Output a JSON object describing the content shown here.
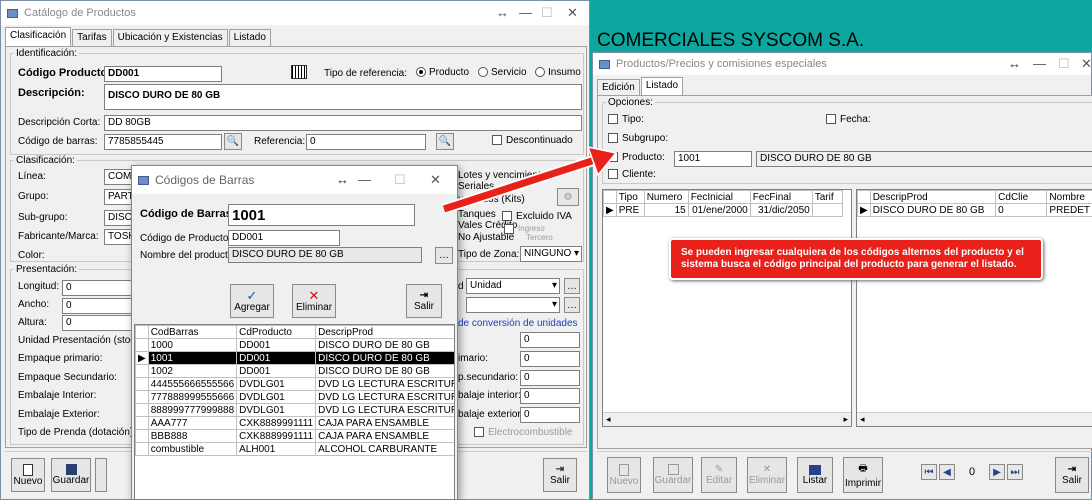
{
  "catalog": {
    "title": "Catálogo de Productos",
    "tabs": [
      "Clasificación",
      "Tarifas",
      "Ubicación y Existencias",
      "Listado"
    ],
    "identificacion": "Identificación:",
    "codigo_label": "Código Producto:",
    "codigo_value": "DD001",
    "tipo_ref_label": "Tipo de referencia:",
    "tipo_ref_options": [
      "Producto",
      "Servicio",
      "Insumo"
    ],
    "descripcion_label": "Descripción:",
    "descripcion_value": "DISCO DURO DE 80 GB",
    "desc_corta_label": "Descripción Corta:",
    "desc_corta_value": "DD 80GB",
    "codigo_barras_label": "Código de barras:",
    "codigo_barras_value": "7785855445",
    "referencia_label": "Referencia:",
    "referencia_value": "0",
    "descontinuado_label": "Descontinuado",
    "clasificacion": "Clasificación:",
    "linea_label": "Línea:",
    "linea_value": "COMP",
    "grupo_label": "Grupo:",
    "grupo_value": "PARTE",
    "subgrupo_label": "Sub-grupo:",
    "subgrupo_value": "DISCO",
    "fabricante_label": "Fabricante/Marca:",
    "fabricante_value": "TOSHI",
    "color_label": "Color:",
    "lotes_label": "Lotes y vencimient",
    "seriales_label": "Seriales",
    "kits_label": "uestados (Kits)",
    "tanques_label": "Tanques",
    "excluido_label": "Excluido IVA",
    "vales_label": "Vales Crédito",
    "no_ajustable_label": "No Ajustable",
    "ingreso_label": "Ingreso",
    "tercero_label": "Tercero",
    "tipo_zona_label": "Tipo de Zona:",
    "tipo_zona_value": "NINGUNO",
    "presentacion": "Presentación:",
    "longitud_label": "Longitud:",
    "longitud_value": "0",
    "ancho_label": "Ancho:",
    "ancho_value": "0",
    "altura_label": "Altura:",
    "altura_value": "0",
    "unidad_label": "d",
    "unidad_value": "Unidad",
    "unidad_pres_label": "Unidad Presentación (stock",
    "conversion_label": "de conversión de unidades",
    "empaque_primario_label": "Empaque primario:",
    "empaque_secundario_label": "Empaque Secundario:",
    "embalaje_interior_label": "Embalaje Interior:",
    "embalaje_exterior_label": "Embalaje Exterior:",
    "tipo_prenda_label": "Tipo de Prenda (dotación):",
    "conv_labels": [
      "imario:",
      "p.secundario:",
      "balaje interior:",
      "balaje exterior:"
    ],
    "conv_values": [
      "0",
      "0",
      "0",
      "0",
      "0"
    ],
    "electro_label": "Electrocombustible",
    "btn_nuevo": "Nuevo",
    "btn_guardar": "Guardar",
    "btn_salir": "Salir"
  },
  "barcodes": {
    "title": "Códigos de Barras",
    "codigo_barras_label": "Código de Barras:",
    "codigo_barras_value": "1001",
    "codigo_producto_label": "Código de Producto:",
    "codigo_producto_value": "DD001",
    "nombre_label": "Nombre del producto:",
    "nombre_value": "DISCO DURO DE 80 GB",
    "btn_agregar": "Agregar",
    "btn_eliminar": "Eliminar",
    "btn_salir": "Salir",
    "columns": [
      "CodBarras",
      "CdProducto",
      "DescripProd"
    ],
    "rows": [
      [
        "1000",
        "DD001",
        "DISCO DURO DE 80 GB"
      ],
      [
        "1001",
        "DD001",
        "DISCO DURO DE 80 GB"
      ],
      [
        "1002",
        "DD001",
        "DISCO DURO DE 80 GB"
      ],
      [
        "444555666555566",
        "DVDLG01",
        "DVD LG LECTURA ESCRITURA"
      ],
      [
        "777888999555666",
        "DVDLG01",
        "DVD LG LECTURA ESCRITURA"
      ],
      [
        "888999777999888",
        "DVDLG01",
        "DVD LG LECTURA ESCRITURA"
      ],
      [
        "AAA777",
        "CXK8889991111",
        "CAJA PARA ENSAMBLE"
      ],
      [
        "BBB888",
        "CXK8889991111",
        "CAJA PARA ENSAMBLE"
      ],
      [
        "combustible",
        "ALH001",
        "ALCOHOL CARBURANTE"
      ]
    ]
  },
  "company": "COMERCIALES SYSCOM S.A.",
  "prices": {
    "title": "Productos/Precios y comisiones especiales",
    "tabs": [
      "Edición",
      "Listado"
    ],
    "opciones": "Opciones:",
    "tipo_label": "Tipo:",
    "fecha_label": "Fecha:",
    "subgrupo_label": "Subgrupo:",
    "producto_label": "Producto:",
    "producto_code": "1001",
    "producto_desc": "DISCO DURO DE 80 GB",
    "cliente_label": "Cliente:",
    "left_columns": [
      "Tipo",
      "Numero",
      "FecInicial",
      "FecFinal",
      "Tarif"
    ],
    "left_row": [
      "PRE",
      "15",
      "01/ene/2000",
      "31/dic/2050",
      ""
    ],
    "right_columns": [
      "DescripProd",
      "CdClie",
      "Nombre"
    ],
    "right_row": [
      "DISCO DURO DE 80 GB",
      "0",
      "PREDET"
    ],
    "callout": "Se pueden ingresar cualquiera de los códigos alternos del producto y el sistema busca el código principal del producto para generar el listado.",
    "btn_nuevo": "Nuevo",
    "btn_guardar": "Guardar",
    "btn_editar": "Editar",
    "btn_eliminar": "Eliminar",
    "btn_listar": "Listar",
    "btn_imprimir": "Imprimir",
    "btn_salir": "Salir",
    "nav_value": "0"
  },
  "colors": {
    "desktop": "#0ea7a0",
    "callout": "#e8211b",
    "selected_row": "#000000"
  }
}
